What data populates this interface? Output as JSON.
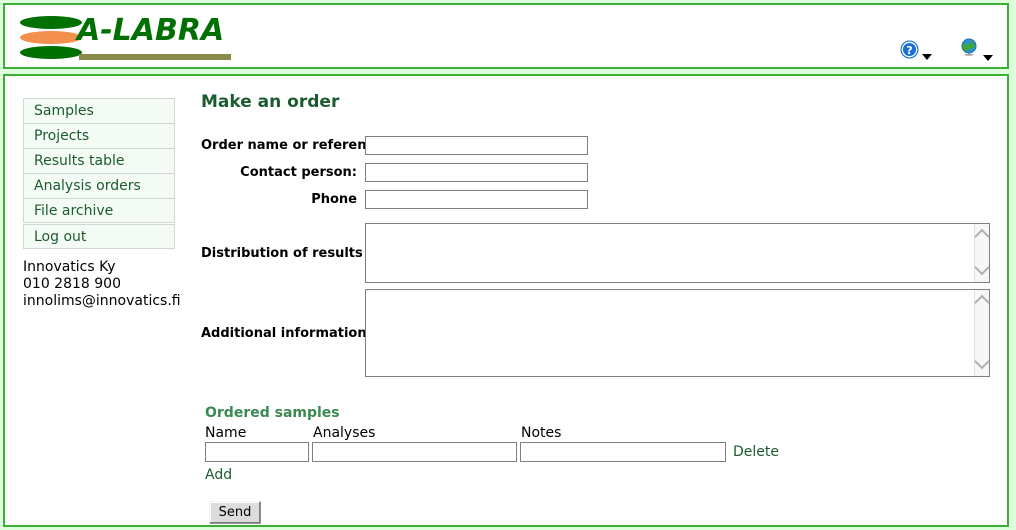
{
  "header": {
    "logo_text": "A-LABRA",
    "logo_mark_name": "three-stacked-ellipses-logo",
    "help_icon": "help-question-icon",
    "language_icon": "globe-icon",
    "colors": {
      "brand_green": "#007000",
      "accent_orange": "#f4904e",
      "logo_bar_olive": "#8a8a4a",
      "panel_border": "#3cb034",
      "page_background": "#ddffdd"
    }
  },
  "sidebar": {
    "items": [
      {
        "label": "Samples"
      },
      {
        "label": "Projects"
      },
      {
        "label": "Results table"
      },
      {
        "label": "Analysis orders"
      },
      {
        "label": "File archive"
      }
    ],
    "logout": {
      "label": "Log out"
    },
    "contact": {
      "company": "Innovatics Ky",
      "phone": "010 2818 900",
      "email": "innolims@innovatics.fi"
    }
  },
  "main": {
    "title": "Make an order",
    "fields": [
      {
        "label": "Order name or reference",
        "value": "",
        "placeholder": ""
      },
      {
        "label": "Contact person:",
        "value": "",
        "placeholder": ""
      },
      {
        "label": "Phone",
        "value": "",
        "placeholder": ""
      }
    ],
    "areas": [
      {
        "label": "Distribution of results",
        "value": "",
        "placeholder": ""
      },
      {
        "label": "Additional information",
        "value": "",
        "placeholder": ""
      }
    ],
    "ordered_samples": {
      "title": "Ordered samples",
      "columns": [
        "Name",
        "Analyses",
        "Notes"
      ],
      "rows": [
        {
          "name": "",
          "analyses": "",
          "notes": "",
          "delete_label": "Delete"
        }
      ],
      "add_label": "Add"
    },
    "send_label": "Send"
  }
}
